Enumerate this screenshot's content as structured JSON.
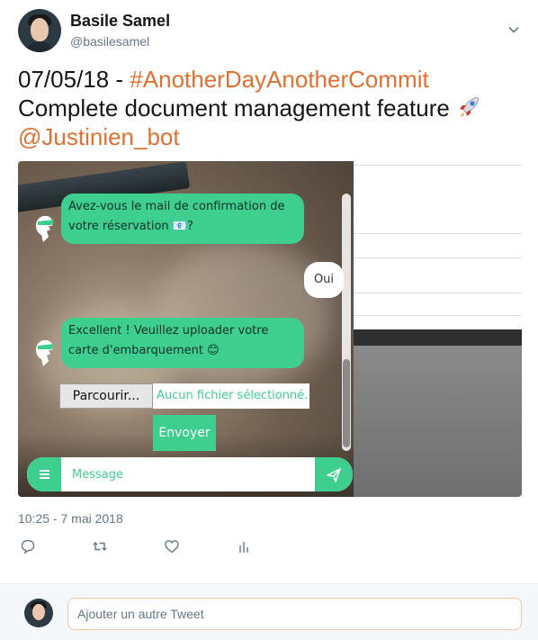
{
  "author": {
    "display_name": "Basile Samel",
    "handle": "@basilesamel"
  },
  "tweet": {
    "date_prefix": "07/05/18 - ",
    "hashtag": "#AnotherDayAnotherCommit",
    "body": "Complete document management feature",
    "emoji_icon": "rocket-icon",
    "mention": "@Justinien_bot",
    "timestamp": "10:25 - 7 mai 2018"
  },
  "chat": {
    "bot_message_1": "Avez-vous le mail de confirmation de votre réservation 📧?",
    "user_reply": "Oui",
    "bot_message_2": "Excellent ! Veuillez uploader votre carte d'embarquement 😊",
    "file_button_label": "Parcourir...",
    "file_status": "Aucun fichier sélectionné.",
    "send_file_label": "Envoyer",
    "message_placeholder": "Message",
    "accent_color": "#3ecf8e"
  },
  "actions": {
    "icons": [
      "reply-icon",
      "retweet-icon",
      "like-icon",
      "analytics-icon"
    ]
  },
  "reply": {
    "placeholder": "Ajouter un autre Tweet"
  },
  "colors": {
    "link": "#e0702f",
    "muted": "#657786",
    "text": "#14171a"
  }
}
